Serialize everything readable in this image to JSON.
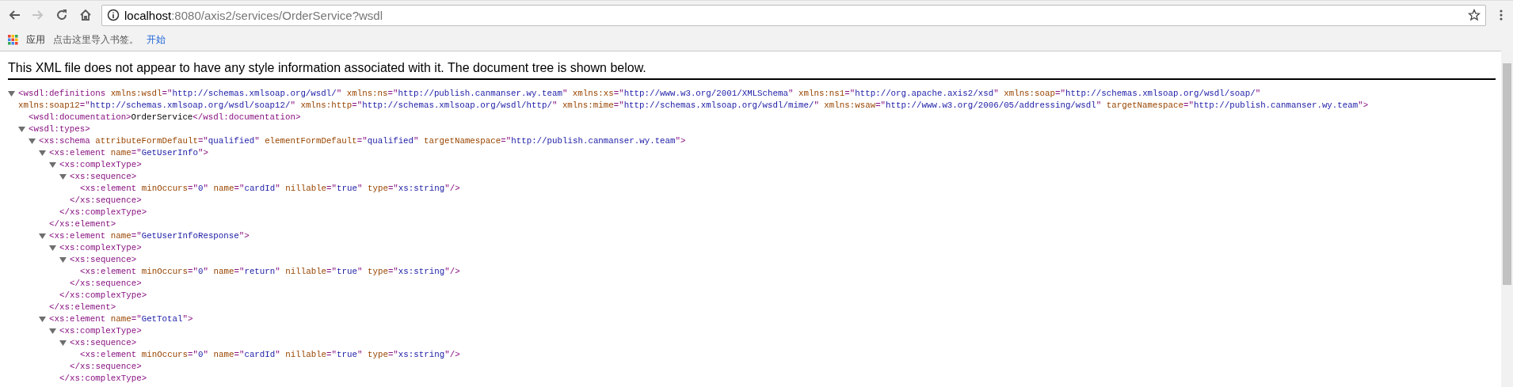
{
  "toolbar": {
    "nav_buttons": [
      {
        "kind": "back",
        "disabled": false
      },
      {
        "kind": "forward",
        "disabled": true
      },
      {
        "kind": "reload",
        "disabled": false
      },
      {
        "kind": "home",
        "disabled": false
      }
    ],
    "address": {
      "host": "localhost",
      "path": ":8080/axis2/services/OrderService?wsdl"
    }
  },
  "bookmarks_bar": {
    "apps_label": "应用",
    "items": [
      {
        "kind": "text",
        "label": "点击这里导入书签。"
      },
      {
        "kind": "link",
        "label": "开始"
      }
    ]
  },
  "xml_viewer": {
    "notice": "This XML file does not appear to have any style information associated with it. The document tree is shown below.",
    "tree": [
      {
        "kind": "element",
        "open": "<wsdl:definitions",
        "open_end": ">",
        "expanded": true,
        "attrs": [
          "xmlns:wsdl=\"http://schemas.xmlsoap.org/wsdl/\"",
          "xmlns:ns=\"http://publish.canmanser.wy.team\"",
          "xmlns:xs=\"http://www.w3.org/2001/XMLSchema\"",
          "xmlns:ns1=\"http://org.apache.axis2/xsd\"",
          "xmlns:soap=\"http://schemas.xmlsoap.org/wsdl/soap/\"",
          "xmlns:soap12=\"http://schemas.xmlsoap.org/wsdl/soap12/\"",
          "xmlns:http=\"http://schemas.xmlsoap.org/wsdl/http/\"",
          "xmlns:mime=\"http://schemas.xmlsoap.org/wsdl/mime/\"",
          "xmlns:wsaw=\"http://www.w3.org/2006/05/addressing/wsdl\"",
          "targetNamespace=\"http://publish.canmanser.wy.team\""
        ],
        "children": [
          {
            "kind": "text_element",
            "open": "<wsdl:documentation",
            "open_end": ">",
            "text": "OrderService",
            "close": "</wsdl:documentation>"
          },
          {
            "kind": "element",
            "open": "<wsdl:types",
            "open_end": ">",
            "expanded": true,
            "children": [
              {
                "kind": "element",
                "open": "<xs:schema",
                "open_end": ">",
                "expanded": true,
                "attrs": [
                  "attributeFormDefault=\"qualified\"",
                  "elementFormDefault=\"qualified\"",
                  "targetNamespace=\"http://publish.canmanser.wy.team\""
                ],
                "children": [
                  {
                    "kind": "element",
                    "open": "<xs:element",
                    "open_end": ">",
                    "expanded": true,
                    "close": "</xs:element>",
                    "attrs": [
                      "name=\"GetUserInfo\""
                    ],
                    "children": [
                      {
                        "kind": "element",
                        "open": "<xs:complexType",
                        "open_end": ">",
                        "expanded": true,
                        "close": "</xs:complexType>",
                        "children": [
                          {
                            "kind": "element",
                            "open": "<xs:sequence",
                            "open_end": ">",
                            "expanded": true,
                            "close": "</xs:sequence>",
                            "children": [
                              {
                                "kind": "leaf",
                                "open": "<xs:element",
                                "open_end": "/>",
                                "attrs": [
                                  "minOccurs=\"0\"",
                                  "name=\"cardId\"",
                                  "nillable=\"true\"",
                                  "type=\"xs:string\""
                                ]
                              }
                            ]
                          }
                        ]
                      }
                    ]
                  },
                  {
                    "kind": "element",
                    "open": "<xs:element",
                    "open_end": ">",
                    "expanded": true,
                    "close": "</xs:element>",
                    "attrs": [
                      "name=\"GetUserInfoResponse\""
                    ],
                    "children": [
                      {
                        "kind": "element",
                        "open": "<xs:complexType",
                        "open_end": ">",
                        "expanded": true,
                        "close": "</xs:complexType>",
                        "children": [
                          {
                            "kind": "element",
                            "open": "<xs:sequence",
                            "open_end": ">",
                            "expanded": true,
                            "close": "</xs:sequence>",
                            "children": [
                              {
                                "kind": "leaf",
                                "open": "<xs:element",
                                "open_end": "/>",
                                "attrs": [
                                  "minOccurs=\"0\"",
                                  "name=\"return\"",
                                  "nillable=\"true\"",
                                  "type=\"xs:string\""
                                ]
                              }
                            ]
                          }
                        ]
                      }
                    ]
                  },
                  {
                    "kind": "element",
                    "open": "<xs:element",
                    "open_end": ">",
                    "expanded": true,
                    "attrs": [
                      "name=\"GetTotal\""
                    ],
                    "children": [
                      {
                        "kind": "element",
                        "open": "<xs:complexType",
                        "open_end": ">",
                        "expanded": true,
                        "close": "</xs:complexType>",
                        "children": [
                          {
                            "kind": "element",
                            "open": "<xs:sequence",
                            "open_end": ">",
                            "expanded": true,
                            "close": "</xs:sequence>",
                            "children": [
                              {
                                "kind": "leaf",
                                "open": "<xs:element",
                                "open_end": "/>",
                                "attrs": [
                                  "minOccurs=\"0\"",
                                  "name=\"cardId\"",
                                  "nillable=\"true\"",
                                  "type=\"xs:string\""
                                ]
                              }
                            ]
                          }
                        ]
                      }
                    ]
                  }
                ]
              }
            ]
          }
        ]
      }
    ]
  }
}
